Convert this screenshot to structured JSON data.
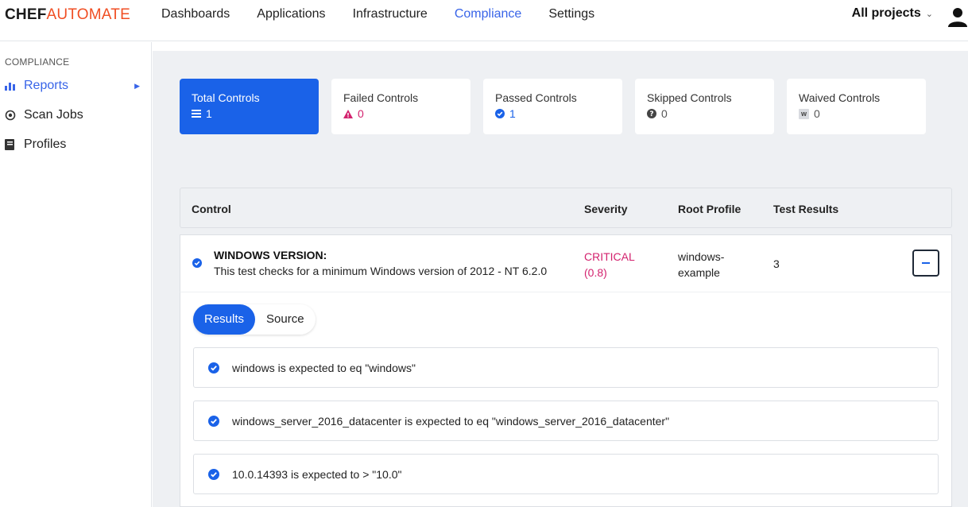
{
  "brand": {
    "chef": "CHEF",
    "automate": "AUTOMATE"
  },
  "nav": {
    "items": [
      "Dashboards",
      "Applications",
      "Infrastructure",
      "Compliance",
      "Settings"
    ],
    "active": "Compliance",
    "projects_label": "All projects",
    "projects_chevron": "⌄"
  },
  "sidebar": {
    "heading": "COMPLIANCE",
    "items": [
      {
        "label": "Reports",
        "icon": "bar-chart-icon",
        "active": true
      },
      {
        "label": "Scan Jobs",
        "icon": "scan-icon",
        "active": false
      },
      {
        "label": "Profiles",
        "icon": "book-icon",
        "active": false
      }
    ]
  },
  "summary": {
    "total": {
      "label": "Total Controls",
      "value": "1"
    },
    "failed": {
      "label": "Failed Controls",
      "value": "0"
    },
    "passed": {
      "label": "Passed Controls",
      "value": "1"
    },
    "skipped": {
      "label": "Skipped Controls",
      "value": "0"
    },
    "waived": {
      "label": "Waived Controls",
      "value": "0",
      "badge": "w"
    }
  },
  "table": {
    "headers": {
      "control": "Control",
      "severity": "Severity",
      "root_profile": "Root Profile",
      "test_results": "Test Results"
    },
    "row": {
      "title": "WINDOWS VERSION:",
      "description": "This test checks for a minimum Windows version of 2012 - NT 6.2.0",
      "severity_level": "CRITICAL",
      "severity_score": "(0.8)",
      "profile_line1": "windows-",
      "profile_line2": "example",
      "test_results": "3"
    }
  },
  "detail": {
    "tabs": [
      "Results",
      "Source"
    ],
    "active_tab": "Results",
    "results": [
      "windows is expected to eq \"windows\"",
      "windows_server_2016_datacenter is expected to eq \"windows_server_2016_datacenter\"",
      "10.0.14393 is expected to > \"10.0\""
    ]
  },
  "colors": {
    "accent": "#1a62e8",
    "nav_active": "#3864e8",
    "critical": "#d3226e",
    "brand_orange": "#f04e23"
  }
}
